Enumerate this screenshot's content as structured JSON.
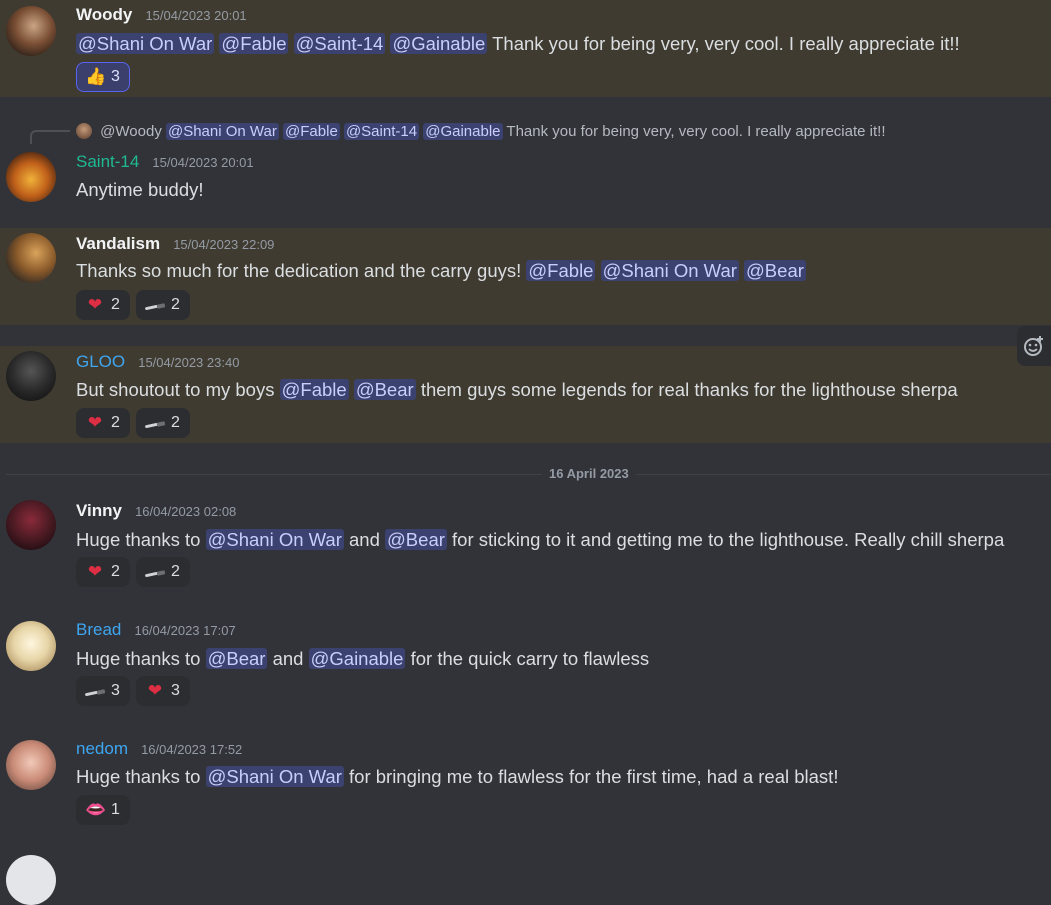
{
  "messages": [
    {
      "author": "Woody",
      "timestamp": "15/04/2023 20:01",
      "mentions": [
        "@Shani On War",
        "@Fable",
        "@Saint-14",
        "@Gainable"
      ],
      "text": "Thank you for being very, very cool.  I really appreciate it!!",
      "reactions": [
        {
          "emoji": "thumbs-up",
          "count": "3"
        }
      ]
    },
    {
      "reply": {
        "author": "@Woody",
        "mentions": [
          "@Shani On War",
          "@Fable",
          "@Saint-14",
          "@Gainable"
        ],
        "text": "Thank you for being very, very cool. I really appreciate it!!"
      },
      "author": "Saint-14",
      "timestamp": "15/04/2023 20:01",
      "text": "Anytime buddy!"
    },
    {
      "author": "Vandalism",
      "timestamp": "15/04/2023 22:09",
      "text": "Thanks so much for the dedication and the carry guys!",
      "mentions": [
        "@Fable",
        "@Shani On War",
        "@Bear"
      ],
      "reactions": [
        {
          "emoji": "heart",
          "count": "2"
        },
        {
          "emoji": "knife",
          "count": "2"
        }
      ]
    },
    {
      "author": "GLOO",
      "timestamp": "15/04/2023 23:40",
      "text_before": "But shoutout to my boys",
      "mentions": [
        "@Fable",
        "@Bear"
      ],
      "text_after": "them guys some legends for real thanks for the lighthouse sherpa",
      "reactions": [
        {
          "emoji": "heart",
          "count": "2"
        },
        {
          "emoji": "knife",
          "count": "2"
        }
      ]
    },
    {
      "author": "Vinny",
      "timestamp": "16/04/2023 02:08",
      "text_1": "Huge thanks to",
      "mention_1": "@Shani On War",
      "text_2": "and",
      "mention_2": "@Bear",
      "text_3": "for sticking to it and getting me to the lighthouse. Really chill sherpa",
      "reactions": [
        {
          "emoji": "heart",
          "count": "2"
        },
        {
          "emoji": "knife",
          "count": "2"
        }
      ]
    },
    {
      "author": "Bread",
      "timestamp": "16/04/2023 17:07",
      "text_1": "Huge thanks to",
      "mention_1": "@Bear",
      "text_2": "and",
      "mention_2": "@Gainable",
      "text_3": "for the quick carry to flawless",
      "reactions": [
        {
          "emoji": "knife",
          "count": "3"
        },
        {
          "emoji": "heart",
          "count": "3"
        }
      ]
    },
    {
      "author": "nedom",
      "timestamp": "16/04/2023 17:52",
      "text_1": "Huge thanks to",
      "mention_1": "@Shani On War",
      "text_2": "for bringing me to flawless for the first time, had a real blast!",
      "reactions": [
        {
          "emoji": "lips",
          "count": "1"
        }
      ]
    }
  ],
  "date_divider": "16 April 2023",
  "colors": {
    "background": "#313338",
    "highlight": "#3f3b31",
    "mention_bg": "#3c4270",
    "mention_fg": "#c9cdfb",
    "green_name": "#1fb992",
    "blue_name": "#3ea6f1"
  }
}
